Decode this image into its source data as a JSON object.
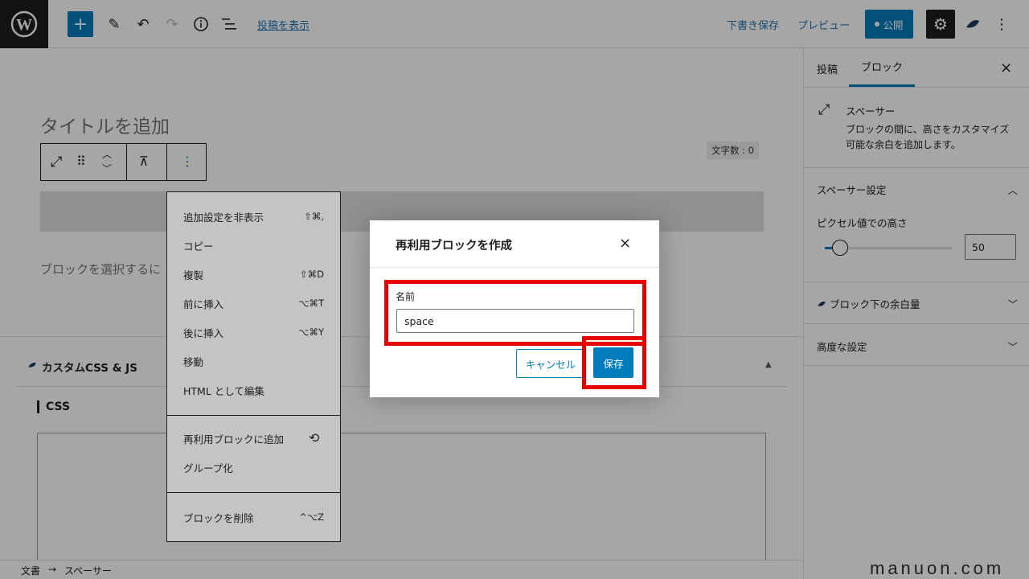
{
  "toolbar": {
    "add_icon": "plus-icon",
    "view_post": "投稿を表示",
    "save_draft": "下書き保存",
    "preview": "プレビュー",
    "publish": "公開"
  },
  "editor": {
    "title_placeholder": "タイトルを追加",
    "char_count": "文字数 : 0",
    "block_hint": "ブロックを選択するに",
    "custom_css_title": "カスタムCSS & JS",
    "css_label": "CSS"
  },
  "context_menu": {
    "items": [
      {
        "label": "追加設定を非表示",
        "shortcut": "⇧⌘,"
      },
      {
        "label": "コピー",
        "shortcut": ""
      },
      {
        "label": "複製",
        "shortcut": "⇧⌘D"
      },
      {
        "label": "前に挿入",
        "shortcut": "⌥⌘T"
      },
      {
        "label": "後に挿入",
        "shortcut": "⌥⌘Y"
      },
      {
        "label": "移動",
        "shortcut": ""
      },
      {
        "label": "HTML として編集",
        "shortcut": ""
      },
      {
        "label": "再利用ブロックに追加",
        "shortcut": ""
      },
      {
        "label": "グループ化",
        "shortcut": ""
      },
      {
        "label": "ブロックを削除",
        "shortcut": "^⌥Z"
      }
    ]
  },
  "sidebar": {
    "tab_post": "投稿",
    "tab_block": "ブロック",
    "block_name": "スペーサー",
    "block_desc": "ブロックの間に、高さをカスタマイズ可能な余白を追加します。",
    "spacer_settings": "スペーサー設定",
    "pixel_height_label": "ピクセル値での高さ",
    "pixel_height_value": "50",
    "slider_fraction": 0.08,
    "margin_below": "ブロック下の余白量",
    "advanced": "高度な設定"
  },
  "modal": {
    "title": "再利用ブロックを作成",
    "name_label": "名前",
    "name_value": "space",
    "cancel": "キャンセル",
    "save": "保存"
  },
  "breadcrumb": {
    "root": "文書",
    "arrow": "→",
    "current": "スペーサー"
  },
  "watermark": "manuon.com",
  "colors": {
    "accent": "#007cba",
    "highlight": "#e60000"
  }
}
